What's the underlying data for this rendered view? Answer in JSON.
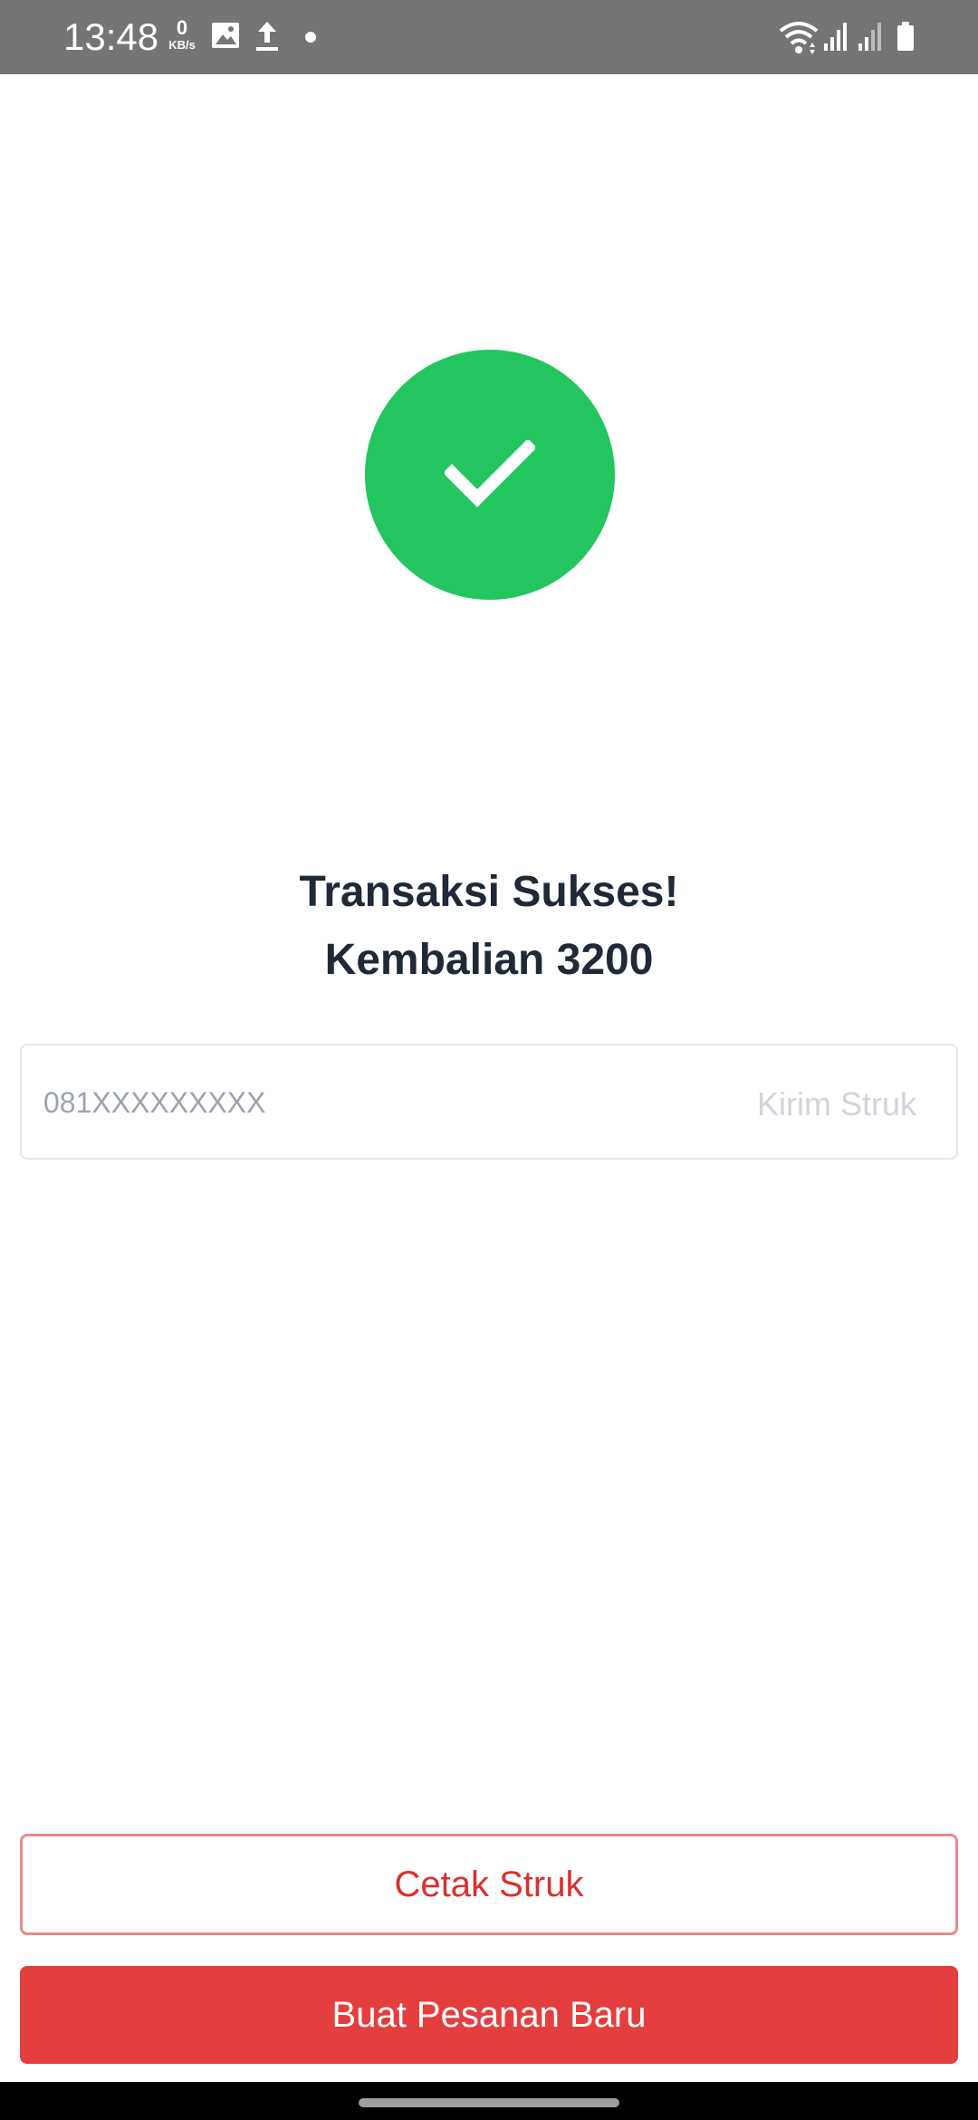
{
  "status_bar": {
    "time": "13:48",
    "speed_value": "0",
    "speed_unit": "KB/s",
    "icons": [
      "gallery-icon",
      "upload-icon",
      "dot-icon",
      "wifi-icon",
      "signal-icon",
      "signal-icon",
      "battery-icon"
    ]
  },
  "success": {
    "icon": "checkmark-icon",
    "color": "#22c55e",
    "title": "Transaksi Sukses!",
    "change_text": "Kembalian 3200"
  },
  "receipt": {
    "phone_placeholder": "081XXXXXXXXX",
    "phone_value": "",
    "send_label": "Kirim Struk"
  },
  "actions": {
    "print_label": "Cetak Struk",
    "new_order_label": "Buat Pesanan Baru",
    "accent_color": "#e53e3e"
  }
}
